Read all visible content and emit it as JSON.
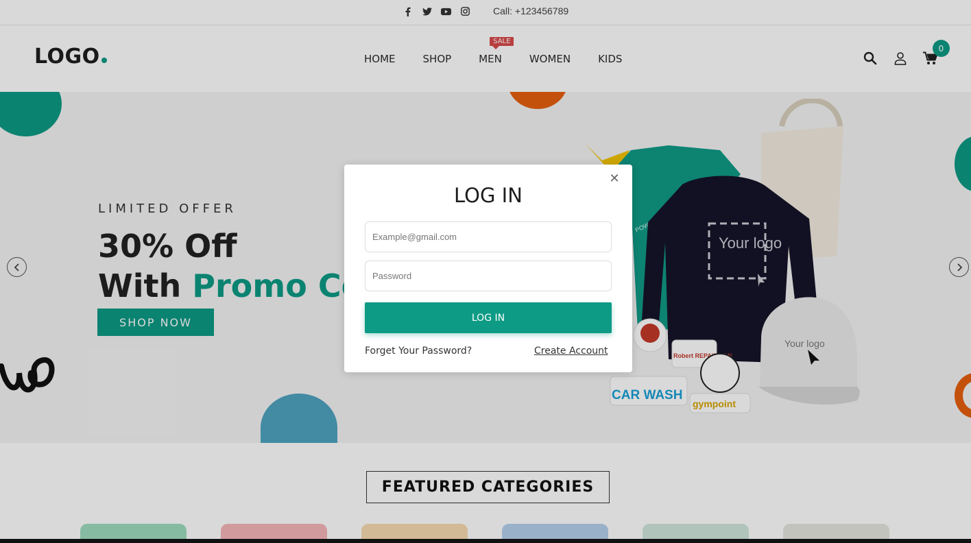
{
  "topbar": {
    "social_icons": [
      "facebook-icon",
      "twitter-icon",
      "youtube-icon",
      "instagram-icon"
    ],
    "call_text": "Call: +123456789"
  },
  "header": {
    "logo_text": "LOGO",
    "nav": [
      {
        "label": "HOME"
      },
      {
        "label": "SHOP"
      },
      {
        "label": "MEN",
        "badge": "SALE"
      },
      {
        "label": "WOMEN"
      },
      {
        "label": "KIDS"
      }
    ],
    "icons": [
      "search-icon",
      "user-icon",
      "cart-icon"
    ],
    "cart_count": "0"
  },
  "hero": {
    "eyebrow": "LIMITED OFFER",
    "headline_line1": "30% Off",
    "headline_line2_prefix": "With ",
    "headline_line2_accent": "Promo Co",
    "cta_label": "SHOP NOW",
    "product_labels": {
      "sweater_logo": "Your logo",
      "cap_logo": "Your logo",
      "sticker_carwash": "CAR WASH",
      "sticker_repairman": "Robert REPAIRMAN",
      "sticker_gym": "gympoint",
      "tshirt_text": "POWER"
    }
  },
  "featured": {
    "title": "FEATURED CATEGORIES"
  },
  "modal": {
    "title": "LOG IN",
    "email_placeholder": "Example@gmail.com",
    "password_placeholder": "Password",
    "submit_label": "LOG IN",
    "forgot_label": "Forget Your Password?",
    "create_label": "Create Account"
  },
  "colors": {
    "accent": "#0e9b85",
    "sale_badge": "#d94a4a",
    "overlay": "rgba(0,0,0,0.15)"
  }
}
